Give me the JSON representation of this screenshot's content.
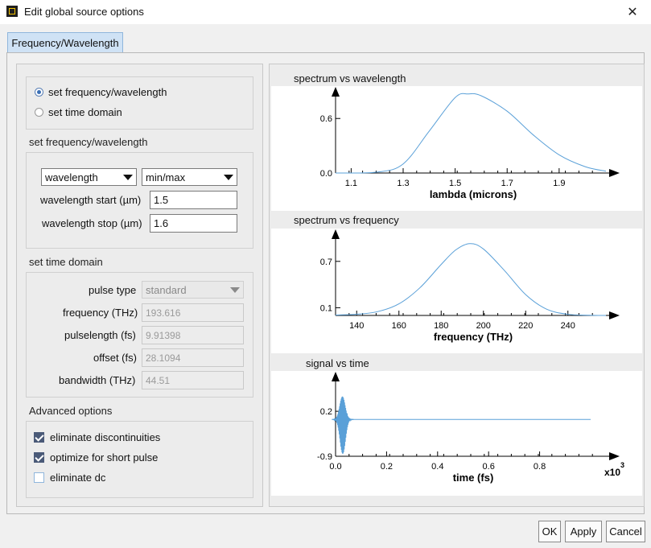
{
  "window": {
    "title": "Edit global source options",
    "close_glyph": "✕"
  },
  "tabs": [
    {
      "label": "Frequency/Wavelength",
      "active": true
    }
  ],
  "mode": {
    "options": [
      {
        "label": "set frequency/wavelength",
        "checked": true
      },
      {
        "label": "set time domain",
        "checked": false
      }
    ]
  },
  "freq_section": {
    "title": "set frequency/wavelength",
    "type_select": "wavelength",
    "range_select": "min/max",
    "start_label": "wavelength start (µm)",
    "start_value": "1.5",
    "stop_label": "wavelength stop (µm)",
    "stop_value": "1.6"
  },
  "time_section": {
    "title": "set time domain",
    "pulse_type_label": "pulse type",
    "pulse_type_value": "standard",
    "fields": [
      {
        "label": "frequency (THz)",
        "value": "193.616"
      },
      {
        "label": "pulselength (fs)",
        "value": "9.91398"
      },
      {
        "label": "offset (fs)",
        "value": "28.1094"
      },
      {
        "label": "bandwidth (THz)",
        "value": "44.51"
      }
    ]
  },
  "advanced": {
    "title": "Advanced options",
    "options": [
      {
        "label": "eliminate discontinuities",
        "checked": true
      },
      {
        "label": "optimize for short pulse",
        "checked": true
      },
      {
        "label": "eliminate dc",
        "checked": false
      }
    ]
  },
  "buttons": {
    "ok": "OK",
    "apply": "Apply",
    "cancel": "Cancel"
  },
  "colors": {
    "curve": "#5aa0d8",
    "tab_bg": "#cfe2f5",
    "checkbox": "#4a5a78"
  },
  "chart_data": [
    {
      "type": "line",
      "title": "spectrum vs wavelength",
      "xlabel": "lambda (microns)",
      "xlim": [
        1.04,
        2.08
      ],
      "ylim": [
        0.0,
        0.85
      ],
      "xticks": [
        "1.1",
        "1.3",
        "1.5",
        "1.7",
        "1.9"
      ],
      "yticks": [
        "0.0",
        "0.6"
      ],
      "series": [
        {
          "x": [
            1.04,
            1.2,
            1.3,
            1.4,
            1.5,
            1.55,
            1.6,
            1.7,
            1.8,
            1.9,
            2.0,
            2.08
          ],
          "y": [
            0.0,
            0.01,
            0.1,
            0.46,
            0.83,
            0.87,
            0.85,
            0.68,
            0.42,
            0.2,
            0.07,
            0.02
          ]
        }
      ]
    },
    {
      "type": "line",
      "title": "spectrum vs frequency",
      "xlabel": "frequency (THz)",
      "xlim": [
        130,
        258
      ],
      "ylim": [
        0.0,
        1.0
      ],
      "xticks": [
        "140",
        "160",
        "180",
        "200",
        "220",
        "240"
      ],
      "yticks": [
        "0.1",
        "0.7"
      ],
      "series": [
        {
          "x": [
            130,
            140,
            150,
            160,
            170,
            180,
            187,
            193.6,
            200,
            210,
            220,
            230,
            240,
            250,
            258
          ],
          "y": [
            0.005,
            0.015,
            0.05,
            0.15,
            0.36,
            0.66,
            0.85,
            0.93,
            0.86,
            0.58,
            0.27,
            0.08,
            0.015,
            0.003,
            0.0
          ]
        }
      ]
    },
    {
      "type": "line",
      "title": "signal vs time",
      "xlabel": "time (fs)",
      "xlim": [
        0,
        1.06
      ],
      "ylim": [
        -0.9,
        0.95
      ],
      "xticks": [
        "0.0",
        "0.2",
        "0.4",
        "0.6",
        "0.8"
      ],
      "yticks": [
        "0.2",
        "-0.9"
      ],
      "x_multiplier": "x10",
      "x_multiplier_exp": "3",
      "series": [
        {
          "name": "",
          "baseline": 0.0,
          "pulse_center": 0.028,
          "pulse_amplitude": 0.9,
          "end_x": 1.0
        }
      ]
    }
  ]
}
